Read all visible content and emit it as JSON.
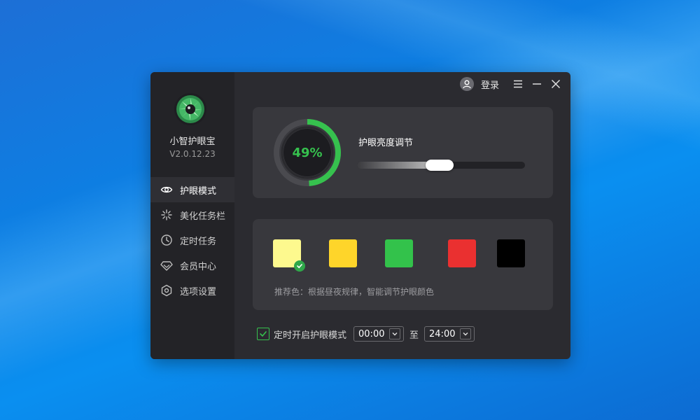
{
  "app": {
    "name": "小智护眼宝",
    "version": "V2.0.12.23"
  },
  "titlebar": {
    "login_label": "登录",
    "menu_icon": "hamburger-menu-icon",
    "minimize_icon": "minimize-icon",
    "close_icon": "close-icon"
  },
  "nav": {
    "items": [
      {
        "label": "护眼模式",
        "icon": "eye-icon",
        "active": true
      },
      {
        "label": "美化任务栏",
        "icon": "sparkle-icon",
        "active": false
      },
      {
        "label": "定时任务",
        "icon": "clock-icon",
        "active": false
      },
      {
        "label": "会员中心",
        "icon": "diamond-icon",
        "active": false
      },
      {
        "label": "选项设置",
        "icon": "settings-icon",
        "active": false
      }
    ]
  },
  "brightness": {
    "percent_label": "49%",
    "percent_value": 49,
    "title": "护眼亮度调节",
    "slider_value": 0.49
  },
  "colors": {
    "swatches": [
      {
        "color": "#fdf98e",
        "selected": true
      },
      {
        "color": "#fed52a",
        "selected": false
      },
      {
        "color": "#33c24b",
        "selected": false
      },
      {
        "color": "#ea3030",
        "selected": false
      },
      {
        "color": "#000000",
        "selected": false
      }
    ],
    "recommend_text": "推荐色：根据昼夜规律，智能调节护眼颜色"
  },
  "timer": {
    "checked": true,
    "label": "定时开启护眼模式",
    "start_time": "00:00",
    "to_label": "至",
    "end_time": "24:00"
  },
  "theme": {
    "accent": "#36c14e",
    "window_bg": "#2b2b30",
    "sidebar_bg": "#232327",
    "card_bg": "#38383d"
  }
}
